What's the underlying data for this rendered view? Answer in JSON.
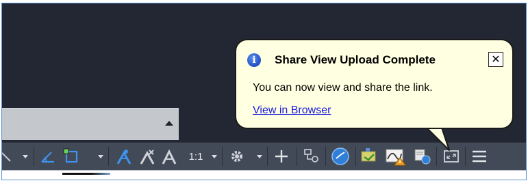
{
  "balloon": {
    "title": "Share View Upload Complete",
    "message": "You can now view and share the link.",
    "link_text": "View in Browser",
    "close_glyph": "✕",
    "info_glyph": "i"
  },
  "status_bar": {
    "annotation_scale": "1:1",
    "icons": [
      "line-weight-icon",
      "isometric-drafting-icon",
      "selection-cycling-icon",
      "annotation-visibility-icon",
      "auto-scale-icon",
      "annotation-scale-icon",
      "workspace-gear-icon",
      "add-icon",
      "quick-properties-icon",
      "hardware-acceleration-icon",
      "clean-screen-icon",
      "customization-menu-icon"
    ]
  },
  "colors": {
    "canvas": "#222733",
    "status_bar": "#434a57",
    "balloon_bg": "#ffffe1",
    "accent_blue": "#2f7fd8",
    "link": "#1a1adc"
  }
}
